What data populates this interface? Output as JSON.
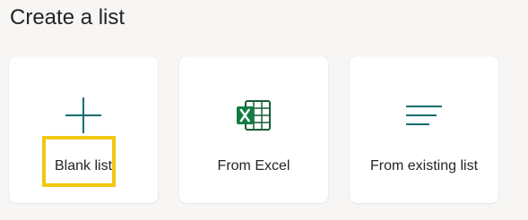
{
  "page": {
    "title": "Create a list"
  },
  "cards": [
    {
      "label": "Blank list",
      "icon": "plus-icon"
    },
    {
      "label": "From Excel",
      "icon": "excel-icon"
    },
    {
      "label": "From existing list",
      "icon": "list-lines-icon"
    }
  ],
  "colors": {
    "accent_teal": "#0f6e6e",
    "excel_green": "#185c37",
    "highlight": "#f2c811",
    "text": "#252423",
    "background": "#f8f6f4"
  }
}
